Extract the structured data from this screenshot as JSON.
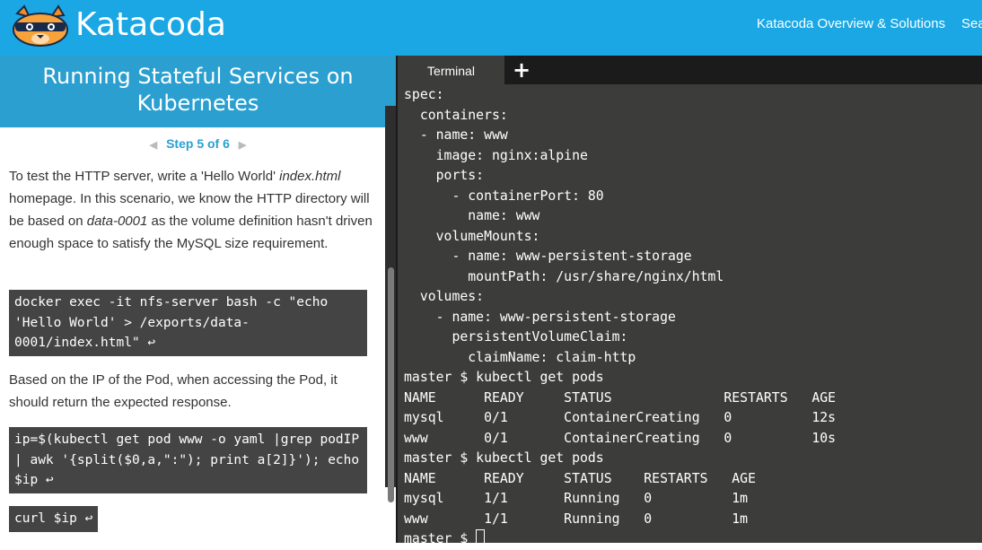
{
  "header": {
    "brand": "Katacoda",
    "nav": [
      "Katacoda Overview & Solutions",
      "Sea"
    ]
  },
  "scenario": {
    "title": "Running Stateful Services on Kubernetes",
    "step": "Step 5 of 6",
    "paragraph1": {
      "before": "To test the HTTP server, write a 'Hello World' ",
      "em1": "index.html",
      "middle": " homepage. In this scenario, we know the HTTP directory will be based on ",
      "em2": "data-0001",
      "after": " as the volume definition hasn't driven enough space to satisfy the MySQL size requirement."
    },
    "code1": "docker exec -it nfs-server bash -c \"echo 'Hello World' > /exports/data-0001/index.html\" ↩",
    "paragraph2": "Based on the IP of the Pod, when accessing the Pod, it should return the expected response.",
    "code2": "ip=$(kubectl get pod www -o yaml |grep podIP | awk '{split($0,a,\":\"); print a[2]}'); echo $ip ↩",
    "code3": "curl $ip ↩"
  },
  "terminal": {
    "tab_label": "Terminal",
    "add_tab": "+",
    "lines": [
      "spec:",
      "  containers:",
      "  - name: www",
      "    image: nginx:alpine",
      "    ports:",
      "      - containerPort: 80",
      "        name: www",
      "    volumeMounts:",
      "      - name: www-persistent-storage",
      "        mountPath: /usr/share/nginx/html",
      "  volumes:",
      "    - name: www-persistent-storage",
      "      persistentVolumeClaim:",
      "        claimName: claim-http",
      "master $ kubectl get pods",
      "NAME      READY     STATUS              RESTARTS   AGE",
      "mysql     0/1       ContainerCreating   0          12s",
      "www       0/1       ContainerCreating   0          10s",
      "master $ kubectl get pods",
      "NAME      READY     STATUS    RESTARTS   AGE",
      "mysql     1/1       Running   0          1m",
      "www       1/1       Running   0          1m"
    ],
    "prompt": "master $ "
  },
  "colors": {
    "header_bg": "#1aa7e3",
    "title_bg": "#2a9fd0",
    "terminal_bg": "#3c3c3a",
    "code_bg": "#444444"
  }
}
